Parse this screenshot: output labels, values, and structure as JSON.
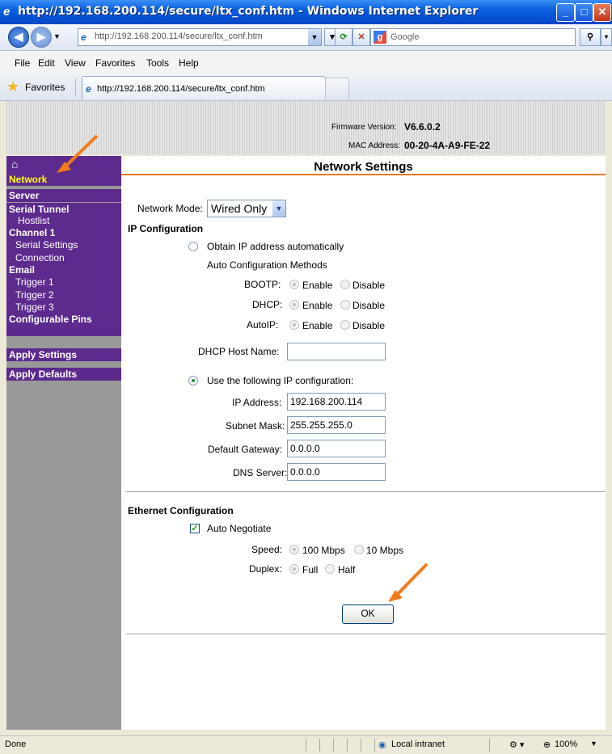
{
  "window": {
    "title": "http://192.168.200.114/secure/ltx_conf.htm - Windows Internet Explorer",
    "address": "http://192.168.200.114/secure/ltx_conf.htm",
    "search_placeholder": "Google"
  },
  "menu": {
    "file": "File",
    "edit": "Edit",
    "view": "View",
    "favorites": "Favorites",
    "tools": "Tools",
    "help": "Help"
  },
  "favbar": {
    "favorites_label": "Favorites",
    "tab_title": "http://192.168.200.114/secure/ltx_conf.htm"
  },
  "header": {
    "firmware_label": "Firmware Version:",
    "firmware_value": "V6.6.0.2",
    "mac_label": "MAC Address:",
    "mac_value": "00-20-4A-A9-FE-22"
  },
  "sidebar": {
    "home_icon": "home-icon",
    "network": "Network",
    "server": "Server",
    "serial_tunnel": "Serial Tunnel",
    "hostlist": "Hostlist",
    "channel1": "Channel 1",
    "serial_settings": "Serial Settings",
    "connection": "Connection",
    "email": "Email",
    "trigger1": "Trigger 1",
    "trigger2": "Trigger 2",
    "trigger3": "Trigger 3",
    "configurable_pins": "Configurable Pins",
    "apply_settings": "Apply Settings",
    "apply_defaults": "Apply Defaults"
  },
  "main": {
    "title": "Network Settings",
    "network_mode_label": "Network Mode:",
    "network_mode_value": "Wired Only",
    "ip_config_heading": "IP Configuration",
    "obtain_auto": "Obtain IP address automatically",
    "auto_methods": "Auto Configuration Methods",
    "bootp": "BOOTP:",
    "dhcp": "DHCP:",
    "autoip": "AutoIP:",
    "enable": "Enable",
    "disable": "Disable",
    "dhcp_host_label": "DHCP Host Name:",
    "dhcp_host_value": "",
    "use_following": "Use the following IP configuration:",
    "ip_label": "IP Address:",
    "ip_value": "192.168.200.114",
    "subnet_label": "Subnet Mask:",
    "subnet_value": "255.255.255.0",
    "gateway_label": "Default Gateway:",
    "gateway_value": "0.0.0.0",
    "dns_label": "DNS Server:",
    "dns_value": "0.0.0.0",
    "eth_heading": "Ethernet Configuration",
    "auto_negotiate": "Auto Negotiate",
    "speed_label": "Speed:",
    "speed_100": "100 Mbps",
    "speed_10": "10 Mbps",
    "duplex_label": "Duplex:",
    "full": "Full",
    "half": "Half",
    "ok": "OK"
  },
  "status": {
    "left": "Done",
    "zone": "Local intranet",
    "zoom": "100%"
  },
  "colors": {
    "sidebar_purple": "#5d2a8e",
    "sidebar_gray": "#999999",
    "active_yellow": "#ffff00",
    "accent_orange": "#e87722"
  }
}
